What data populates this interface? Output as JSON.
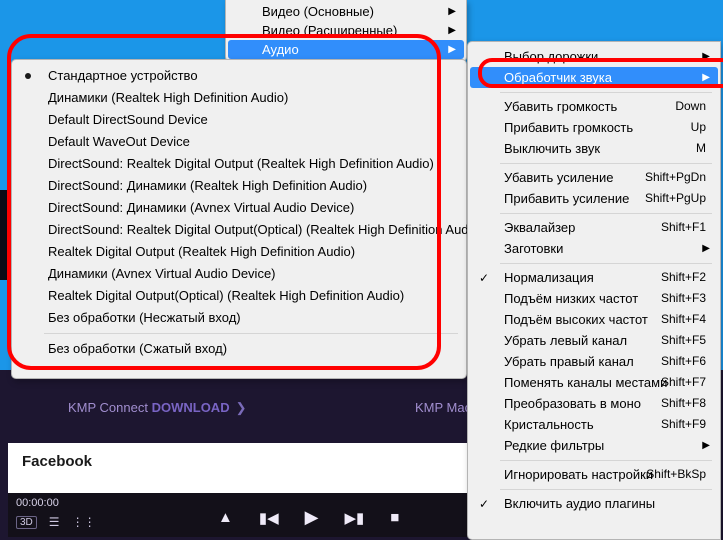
{
  "top_menu": [
    {
      "label": "Видео (Основные)",
      "arrow": true,
      "sel": false
    },
    {
      "label": "Видео (Расширенные)",
      "arrow": true,
      "sel": false
    },
    {
      "label": "Аудио",
      "arrow": true,
      "sel": true
    }
  ],
  "devices": [
    {
      "label": "Стандартное устройство",
      "radio": true
    },
    {
      "label": "Динамики (Realtek High Definition Audio)"
    },
    {
      "label": "Default DirectSound Device"
    },
    {
      "label": "Default WaveOut Device"
    },
    {
      "label": "DirectSound: Realtek Digital Output (Realtek High Definition Audio)"
    },
    {
      "label": "DirectSound: Динамики (Realtek High Definition Audio)"
    },
    {
      "label": "DirectSound: Динамики (Avnex Virtual Audio Device)"
    },
    {
      "label": "DirectSound: Realtek Digital Output(Optical) (Realtek High Definition Audio)"
    },
    {
      "label": "Realtek Digital Output (Realtek High Definition Audio)"
    },
    {
      "label": "Динамики (Avnex Virtual Audio Device)"
    },
    {
      "label": "Realtek Digital Output(Optical) (Realtek High Definition Audio)"
    },
    {
      "label": "Без обработки (Несжатый вход)"
    },
    {
      "sep": true
    },
    {
      "label": "Без обработки (Сжатый вход)"
    }
  ],
  "right": [
    {
      "label": "Выбор дорожки",
      "arrow": true
    },
    {
      "label": "Обработчик звука",
      "arrow": true,
      "sel": true
    },
    {
      "sep": true
    },
    {
      "label": "Убавить громкость",
      "shortcut": "Down"
    },
    {
      "label": "Прибавить громкость",
      "shortcut": "Up"
    },
    {
      "label": "Выключить звук",
      "shortcut": "M"
    },
    {
      "sep": true
    },
    {
      "label": "Убавить усиление",
      "shortcut": "Shift+PgDn"
    },
    {
      "label": "Прибавить усиление",
      "shortcut": "Shift+PgUp"
    },
    {
      "sep": true
    },
    {
      "label": "Эквалайзер",
      "shortcut": "Shift+F1"
    },
    {
      "label": "Заготовки",
      "arrow": true
    },
    {
      "sep": true
    },
    {
      "label": "Нормализация",
      "shortcut": "Shift+F2",
      "check": true
    },
    {
      "label": "Подъём низких частот",
      "shortcut": "Shift+F3"
    },
    {
      "label": "Подъём высоких частот",
      "shortcut": "Shift+F4"
    },
    {
      "label": "Убрать левый канал",
      "shortcut": "Shift+F5"
    },
    {
      "label": "Убрать правый канал",
      "shortcut": "Shift+F6"
    },
    {
      "label": "Поменять каналы местами",
      "shortcut": "Shift+F7"
    },
    {
      "label": "Преобразовать в моно",
      "shortcut": "Shift+F8"
    },
    {
      "label": "Кристальность",
      "shortcut": "Shift+F9"
    },
    {
      "label": "Редкие фильтры",
      "arrow": true
    },
    {
      "sep": true
    },
    {
      "label": "Игнорировать настройки",
      "shortcut": "Shift+BkSp"
    },
    {
      "sep": true
    },
    {
      "label": "Включить аудио плагины",
      "check": true
    }
  ],
  "downloads": {
    "left_a": "KMP Connect ",
    "left_b": "DOWNLOAD",
    "right": "KMP Mac D"
  },
  "facebook": {
    "title": "Facebook"
  },
  "time": "00:00:00",
  "ctrl": {
    "threeD": "3D"
  }
}
